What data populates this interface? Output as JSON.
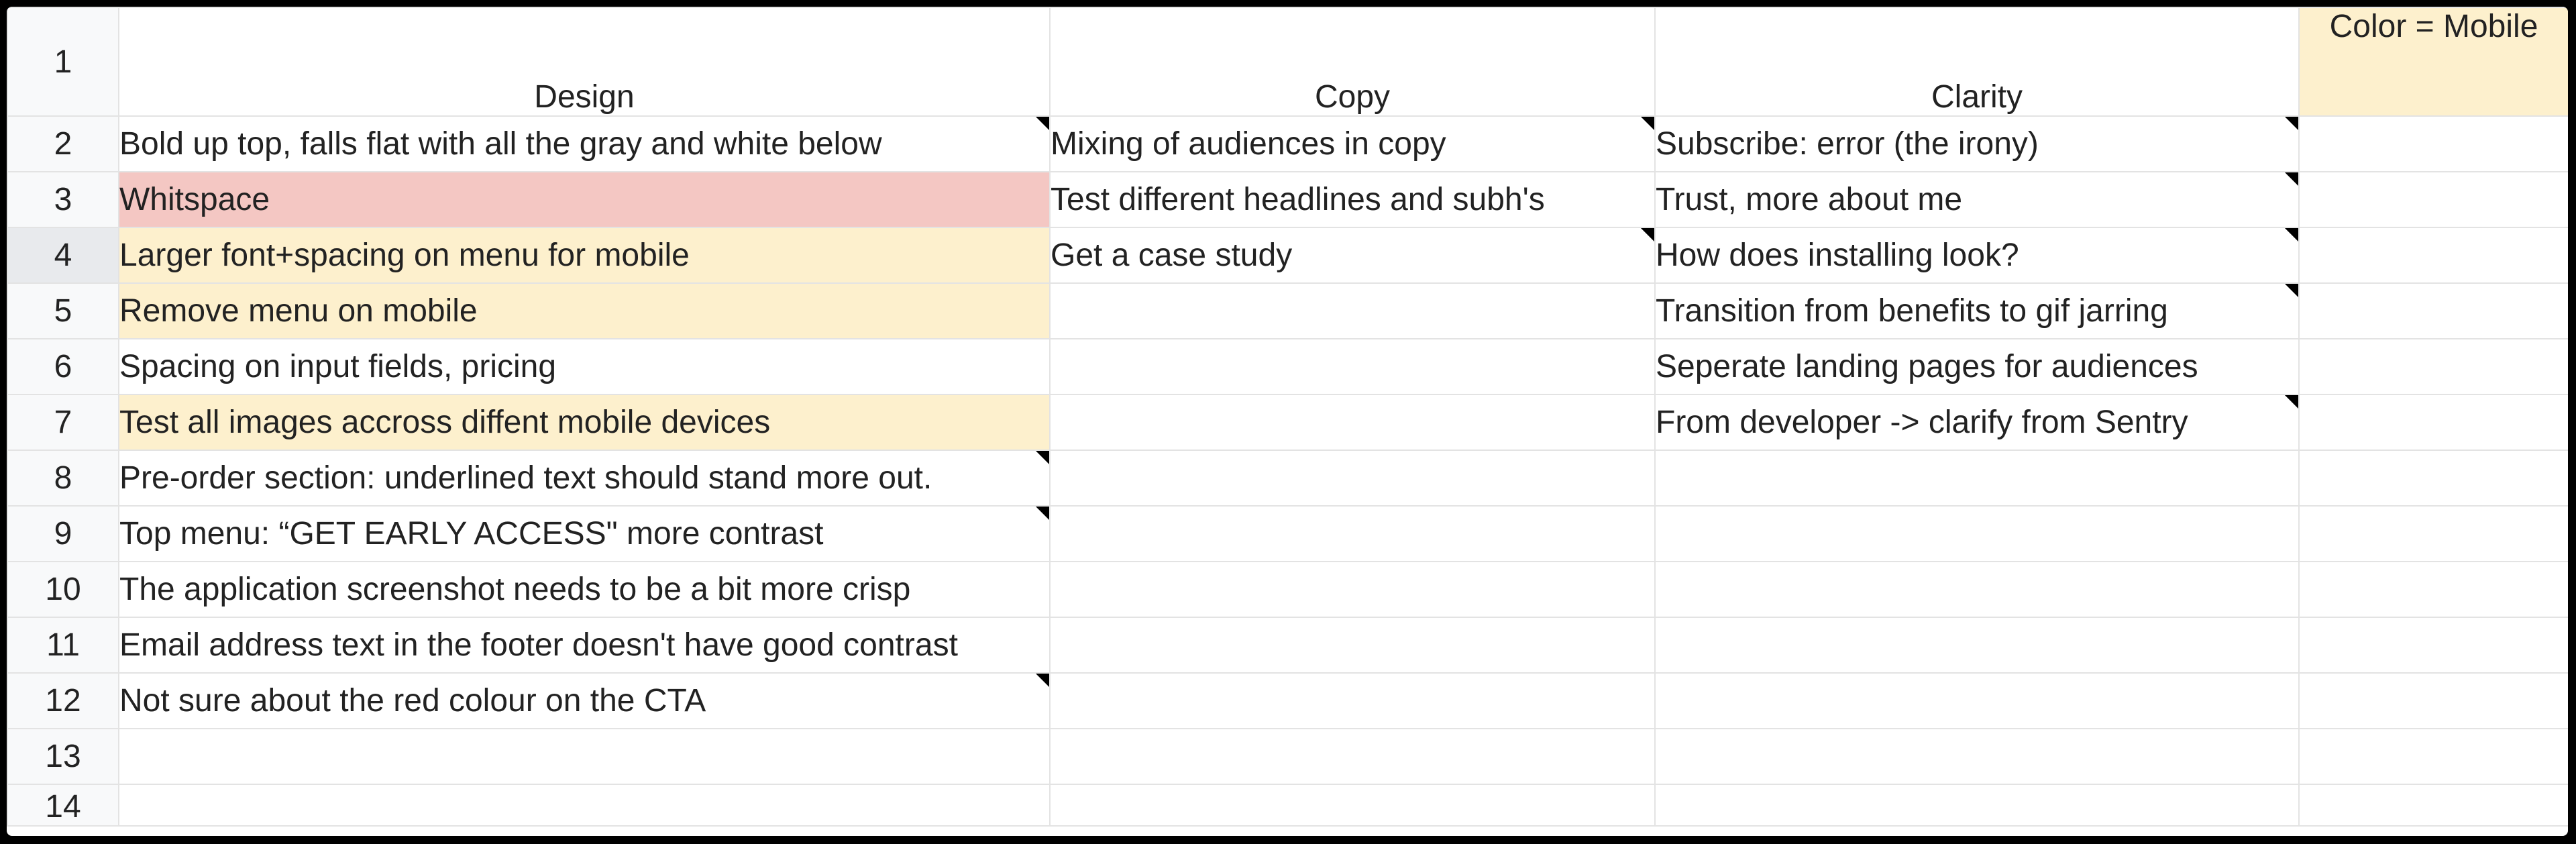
{
  "colors": {
    "pink_fill": "#f4c7c3",
    "yellow_fill": "#fdf0cd",
    "note_marker": "#000000"
  },
  "row_numbers": [
    "1",
    "2",
    "3",
    "4",
    "5",
    "6",
    "7",
    "8",
    "9",
    "10",
    "11",
    "12",
    "13",
    "14"
  ],
  "headers": {
    "design": "Design",
    "copy": "Copy",
    "clarity": "Clarity",
    "legend": "Color = Mobile"
  },
  "design": [
    "Bold up top, falls flat with all the gray and white below",
    "Whitspace",
    "Larger font+spacing on menu for mobile",
    "Remove menu on mobile",
    "Spacing on input fields, pricing",
    "Test all images accross diffent mobile devices",
    "Pre-order section: underlined text should stand more out.",
    "Top menu: “GET EARLY ACCESS\" more contrast",
    "The application screenshot needs to be a bit more crisp",
    "Email address text in the footer doesn't have good contrast",
    "Not sure about the red colour on the CTA"
  ],
  "copy": [
    "Mixing of audiences in copy",
    "Test different headlines and subh's",
    "Get a case study"
  ],
  "clarity": [
    "Subscribe: error (the irony)",
    "Trust, more about me",
    "How does installing look?",
    "Transition from benefits to gif jarring",
    "Seperate landing pages for audiences",
    "From developer -> clarify from Sentry"
  ]
}
